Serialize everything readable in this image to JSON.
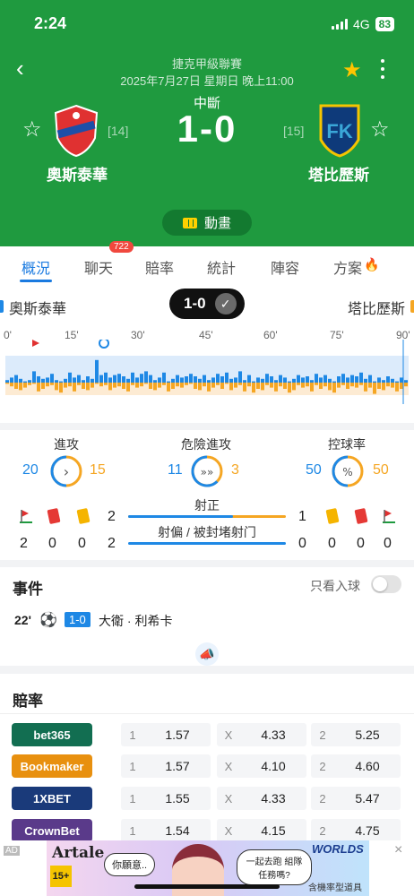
{
  "status_bar": {
    "time": "2:24",
    "network": "4G",
    "battery": "83"
  },
  "match": {
    "league": "捷克甲級聯賽",
    "kickoff": "2025年7月27日 星期日 晚上11:00",
    "status": "中斷",
    "score": "1-0",
    "home": {
      "name": "奧斯泰華",
      "rank": "[14]",
      "crest": "ostrava-crest-icon"
    },
    "away": {
      "name": "塔比歷斯",
      "rank": "[15]",
      "crest": "teplice-crest-icon"
    },
    "animation_label": "動畫"
  },
  "tabs": [
    {
      "label": "概況",
      "active": true
    },
    {
      "label": "聊天",
      "badge": "722"
    },
    {
      "label": "賠率"
    },
    {
      "label": "統計"
    },
    {
      "label": "陣容"
    },
    {
      "label": "方案"
    }
  ],
  "timeline": {
    "home_name": "奧斯泰華",
    "away_name": "塔比歷斯",
    "score": "1-0",
    "axis_labels": [
      "0'",
      "15'",
      "30'",
      "45'",
      "60'",
      "75'",
      "90'"
    ],
    "events": [
      {
        "minute": 6,
        "type": "corner"
      },
      {
        "minute": 22,
        "type": "goal"
      }
    ],
    "pressure_home": [
      0.1,
      0.2,
      0.3,
      0.15,
      0.05,
      0.1,
      0.45,
      0.25,
      0.15,
      0.2,
      0.35,
      0.1,
      0.05,
      0.15,
      0.4,
      0.2,
      0.3,
      0.1,
      0.25,
      0.15,
      0.9,
      0.3,
      0.4,
      0.2,
      0.3,
      0.35,
      0.25,
      0.15,
      0.4,
      0.2,
      0.35,
      0.45,
      0.3,
      0.1,
      0.2,
      0.4,
      0.05,
      0.15,
      0.3,
      0.2,
      0.25,
      0.35,
      0.25,
      0.15,
      0.3,
      0.1,
      0.2,
      0.35,
      0.25,
      0.4,
      0.15,
      0.2,
      0.45,
      0.1,
      0.3,
      0.05,
      0.2,
      0.15,
      0.35,
      0.25,
      0.1,
      0.3,
      0.2,
      0.05,
      0.15,
      0.3,
      0.2,
      0.25,
      0.1,
      0.35,
      0.2,
      0.3,
      0.15,
      0.05,
      0.25,
      0.35,
      0.2,
      0.3,
      0.25,
      0.4,
      0.15,
      0.3,
      0.05,
      0.2,
      0.1,
      0.25,
      0.15,
      0.05,
      0.2,
      0.1
    ],
    "pressure_away": [
      0.05,
      0.15,
      0.25,
      0.3,
      0.2,
      0.1,
      0.05,
      0.35,
      0.25,
      0.15,
      0.1,
      0.3,
      0.4,
      0.2,
      0.15,
      0.35,
      0.1,
      0.25,
      0.3,
      0.2,
      0.05,
      0.15,
      0.1,
      0.3,
      0.2,
      0.15,
      0.25,
      0.35,
      0.1,
      0.2,
      0.15,
      0.05,
      0.25,
      0.3,
      0.2,
      0.1,
      0.35,
      0.25,
      0.15,
      0.2,
      0.1,
      0.05,
      0.25,
      0.3,
      0.15,
      0.35,
      0.2,
      0.1,
      0.25,
      0.05,
      0.3,
      0.2,
      0.1,
      0.35,
      0.15,
      0.4,
      0.25,
      0.3,
      0.1,
      0.2,
      0.35,
      0.15,
      0.25,
      0.4,
      0.3,
      0.1,
      0.2,
      0.15,
      0.35,
      0.1,
      0.25,
      0.15,
      0.3,
      0.4,
      0.2,
      0.1,
      0.25,
      0.15,
      0.2,
      0.1,
      0.35,
      0.2,
      0.45,
      0.25,
      0.3,
      0.15,
      0.2,
      0.35,
      0.25,
      0.15
    ]
  },
  "stats": {
    "attack": {
      "label": "進攻",
      "home": "20",
      "away": "15"
    },
    "dangerous": {
      "label": "危險進攻",
      "home": "11",
      "away": "3"
    },
    "possession": {
      "label": "控球率",
      "home": "50",
      "away": "50"
    },
    "home_cards": {
      "corners": "2",
      "red": "0",
      "yellow": "0"
    },
    "away_cards": {
      "corners": "0",
      "red": "0",
      "yellow": "0"
    },
    "shots_on": {
      "label": "射正",
      "home": "2",
      "away": "1"
    },
    "shots_off": {
      "label": "射偏 / 被封堵射门",
      "home": "2",
      "away": "0"
    },
    "colors": {
      "home": "#1e88e5",
      "away": "#f5a623"
    }
  },
  "events": {
    "title": "事件",
    "only_goals_label": "只看入球",
    "items": [
      {
        "minute": "22'",
        "type": "goal",
        "score": "1-0",
        "player": "大衛 · 利希卡"
      }
    ]
  },
  "odds": {
    "title": "賠率",
    "rows": [
      {
        "bookmaker": "bet365",
        "color": "#126e51",
        "home_key": "1",
        "home": "1.57",
        "draw_key": "X",
        "draw": "4.33",
        "away_key": "2",
        "away": "5.25"
      },
      {
        "bookmaker": "Bookmaker",
        "color": "#e8900f",
        "home_key": "1",
        "home": "1.57",
        "draw_key": "X",
        "draw": "4.10",
        "away_key": "2",
        "away": "4.60"
      },
      {
        "bookmaker": "1XBET",
        "color": "#1a3a7a",
        "home_key": "1",
        "home": "1.55",
        "draw_key": "X",
        "draw": "4.33",
        "away_key": "2",
        "away": "5.47"
      },
      {
        "bookmaker": "CrownBet",
        "color": "#5a3a8a",
        "home_key": "1",
        "home": "1.54",
        "draw_key": "X",
        "draw": "4.15",
        "away_key": "2",
        "away": "4.75"
      }
    ]
  },
  "ad": {
    "label": "AD",
    "logo": "Artale",
    "age_rating": "15+",
    "bubble_left": "你願意..",
    "bubble_right": "一起去跑 組隊任務嗎?",
    "brand": "WORLDS",
    "note": "含機率型道具"
  }
}
